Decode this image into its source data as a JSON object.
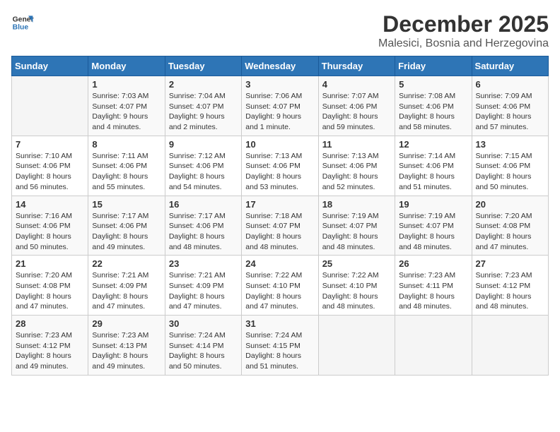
{
  "header": {
    "logo_line1": "General",
    "logo_line2": "Blue",
    "month": "December 2025",
    "location": "Malesici, Bosnia and Herzegovina"
  },
  "weekdays": [
    "Sunday",
    "Monday",
    "Tuesday",
    "Wednesday",
    "Thursday",
    "Friday",
    "Saturday"
  ],
  "weeks": [
    [
      {
        "day": "",
        "info": ""
      },
      {
        "day": "1",
        "info": "Sunrise: 7:03 AM\nSunset: 4:07 PM\nDaylight: 9 hours\nand 4 minutes."
      },
      {
        "day": "2",
        "info": "Sunrise: 7:04 AM\nSunset: 4:07 PM\nDaylight: 9 hours\nand 2 minutes."
      },
      {
        "day": "3",
        "info": "Sunrise: 7:06 AM\nSunset: 4:07 PM\nDaylight: 9 hours\nand 1 minute."
      },
      {
        "day": "4",
        "info": "Sunrise: 7:07 AM\nSunset: 4:06 PM\nDaylight: 8 hours\nand 59 minutes."
      },
      {
        "day": "5",
        "info": "Sunrise: 7:08 AM\nSunset: 4:06 PM\nDaylight: 8 hours\nand 58 minutes."
      },
      {
        "day": "6",
        "info": "Sunrise: 7:09 AM\nSunset: 4:06 PM\nDaylight: 8 hours\nand 57 minutes."
      }
    ],
    [
      {
        "day": "7",
        "info": "Sunrise: 7:10 AM\nSunset: 4:06 PM\nDaylight: 8 hours\nand 56 minutes."
      },
      {
        "day": "8",
        "info": "Sunrise: 7:11 AM\nSunset: 4:06 PM\nDaylight: 8 hours\nand 55 minutes."
      },
      {
        "day": "9",
        "info": "Sunrise: 7:12 AM\nSunset: 4:06 PM\nDaylight: 8 hours\nand 54 minutes."
      },
      {
        "day": "10",
        "info": "Sunrise: 7:13 AM\nSunset: 4:06 PM\nDaylight: 8 hours\nand 53 minutes."
      },
      {
        "day": "11",
        "info": "Sunrise: 7:13 AM\nSunset: 4:06 PM\nDaylight: 8 hours\nand 52 minutes."
      },
      {
        "day": "12",
        "info": "Sunrise: 7:14 AM\nSunset: 4:06 PM\nDaylight: 8 hours\nand 51 minutes."
      },
      {
        "day": "13",
        "info": "Sunrise: 7:15 AM\nSunset: 4:06 PM\nDaylight: 8 hours\nand 50 minutes."
      }
    ],
    [
      {
        "day": "14",
        "info": "Sunrise: 7:16 AM\nSunset: 4:06 PM\nDaylight: 8 hours\nand 50 minutes."
      },
      {
        "day": "15",
        "info": "Sunrise: 7:17 AM\nSunset: 4:06 PM\nDaylight: 8 hours\nand 49 minutes."
      },
      {
        "day": "16",
        "info": "Sunrise: 7:17 AM\nSunset: 4:06 PM\nDaylight: 8 hours\nand 48 minutes."
      },
      {
        "day": "17",
        "info": "Sunrise: 7:18 AM\nSunset: 4:07 PM\nDaylight: 8 hours\nand 48 minutes."
      },
      {
        "day": "18",
        "info": "Sunrise: 7:19 AM\nSunset: 4:07 PM\nDaylight: 8 hours\nand 48 minutes."
      },
      {
        "day": "19",
        "info": "Sunrise: 7:19 AM\nSunset: 4:07 PM\nDaylight: 8 hours\nand 48 minutes."
      },
      {
        "day": "20",
        "info": "Sunrise: 7:20 AM\nSunset: 4:08 PM\nDaylight: 8 hours\nand 47 minutes."
      }
    ],
    [
      {
        "day": "21",
        "info": "Sunrise: 7:20 AM\nSunset: 4:08 PM\nDaylight: 8 hours\nand 47 minutes."
      },
      {
        "day": "22",
        "info": "Sunrise: 7:21 AM\nSunset: 4:09 PM\nDaylight: 8 hours\nand 47 minutes."
      },
      {
        "day": "23",
        "info": "Sunrise: 7:21 AM\nSunset: 4:09 PM\nDaylight: 8 hours\nand 47 minutes."
      },
      {
        "day": "24",
        "info": "Sunrise: 7:22 AM\nSunset: 4:10 PM\nDaylight: 8 hours\nand 47 minutes."
      },
      {
        "day": "25",
        "info": "Sunrise: 7:22 AM\nSunset: 4:10 PM\nDaylight: 8 hours\nand 48 minutes."
      },
      {
        "day": "26",
        "info": "Sunrise: 7:23 AM\nSunset: 4:11 PM\nDaylight: 8 hours\nand 48 minutes."
      },
      {
        "day": "27",
        "info": "Sunrise: 7:23 AM\nSunset: 4:12 PM\nDaylight: 8 hours\nand 48 minutes."
      }
    ],
    [
      {
        "day": "28",
        "info": "Sunrise: 7:23 AM\nSunset: 4:12 PM\nDaylight: 8 hours\nand 49 minutes."
      },
      {
        "day": "29",
        "info": "Sunrise: 7:23 AM\nSunset: 4:13 PM\nDaylight: 8 hours\nand 49 minutes."
      },
      {
        "day": "30",
        "info": "Sunrise: 7:24 AM\nSunset: 4:14 PM\nDaylight: 8 hours\nand 50 minutes."
      },
      {
        "day": "31",
        "info": "Sunrise: 7:24 AM\nSunset: 4:15 PM\nDaylight: 8 hours\nand 51 minutes."
      },
      {
        "day": "",
        "info": ""
      },
      {
        "day": "",
        "info": ""
      },
      {
        "day": "",
        "info": ""
      }
    ]
  ]
}
